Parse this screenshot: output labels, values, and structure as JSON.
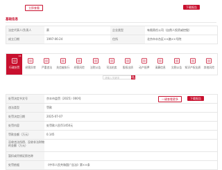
{
  "topbar": {
    "left_button": "立即查看",
    "right_button": "下载报告"
  },
  "company_section": {
    "title": "基础信息",
    "rows": [
      {
        "l1": "法定代表人/负责人",
        "v1": "蔡",
        "l2": "企业类型",
        "v2": "有限责任公司（自然人投资或控股）"
      },
      {
        "l1": "成立日期",
        "v1": "1997-06-24",
        "l2": "住所",
        "v2": "北京市丰台区××路××号院"
      }
    ]
  },
  "tabs": [
    {
      "label": "行政处罚",
      "count": "16",
      "icon": "gavel-icon",
      "active": true
    },
    {
      "label": "经营异常",
      "count": "",
      "icon": "warning-icon",
      "active": false
    },
    {
      "label": "严重违法",
      "count": "",
      "icon": "alert-icon",
      "active": false
    },
    {
      "label": "失信被执行",
      "count": "",
      "icon": "person-icon",
      "active": false
    },
    {
      "label": "经营风险",
      "count": "",
      "icon": "chart-icon",
      "active": false
    },
    {
      "label": "法院公告",
      "count": "",
      "icon": "megaphone-icon",
      "active": false
    },
    {
      "label": "司法拍卖",
      "count": "",
      "icon": "hammer-icon",
      "active": false
    },
    {
      "label": "股权出质",
      "count": "",
      "icon": "share-icon",
      "active": false
    },
    {
      "label": "动产抵押",
      "count": "",
      "icon": "mortgage-icon",
      "active": false
    },
    {
      "label": "清算信息",
      "count": "",
      "icon": "clipboard-icon",
      "active": false
    },
    {
      "label": "欠税公告",
      "count": "",
      "icon": "tax-icon",
      "active": false
    },
    {
      "label": "知识产权出质",
      "count": "",
      "icon": "ip-icon",
      "active": false
    },
    {
      "label": "其他风险",
      "count": "",
      "icon": "more-icon",
      "active": false
    }
  ],
  "search": {
    "placeholder": "请输入关键词"
  },
  "detail_section": {
    "rows": [
      {
        "label": "处罚决定书文号",
        "value": "京丰市监罚〔2025〕000号",
        "tall": false,
        "badge": "",
        "tag": "",
        "tag2": ""
      },
      {
        "label": "违法类型",
        "value": "罚款",
        "tall": false,
        "badge": "",
        "tag": "",
        "tag2": ""
      },
      {
        "label": "处罚决定日期",
        "value": "2025-07-07",
        "tall": false,
        "badge": "",
        "tag": "",
        "tag2": ""
      },
      {
        "label": "处罚内容",
        "value": "处罚款人民币1450元",
        "tall": false,
        "badge": "",
        "tag": "",
        "tag2": ""
      },
      {
        "label": "罚款金额（万元）",
        "value": "0.145",
        "tall": false,
        "badge": "",
        "tag": "",
        "tag2": ""
      },
      {
        "label": "没收违法所得、没收非法财物的金额（万元）",
        "value": "",
        "tall": true,
        "badge": "",
        "tag": "",
        "tag2": ""
      },
      {
        "label": "暂扣或吊销证照名称",
        "value": "",
        "tall": false,
        "badge": "",
        "tag": "",
        "tag2": ""
      },
      {
        "label": "处罚依据",
        "value": "《中华人民共和国广告法》第××条",
        "tall": false,
        "badge": "",
        "tag": "",
        "tag2": ""
      }
    ],
    "right_button_1": "一键查看更多",
    "right_button_2": "下载报告"
  }
}
